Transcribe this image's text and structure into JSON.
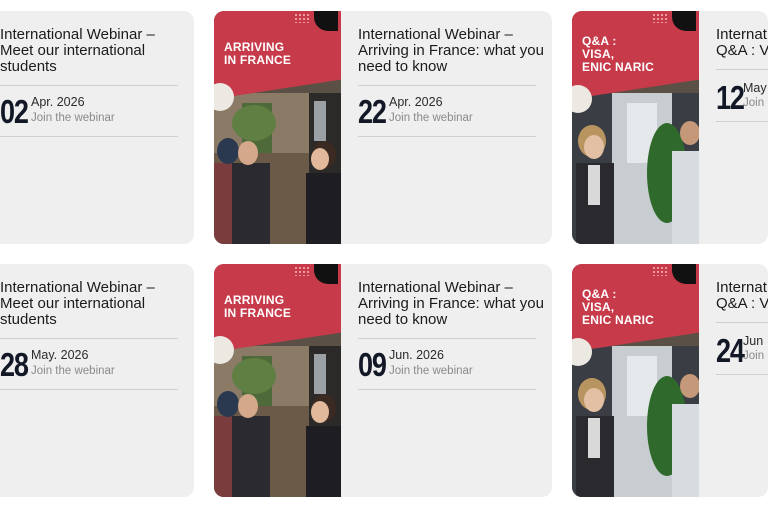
{
  "cards": [
    {
      "title": "International Webinar – Meet our international students",
      "day": "02",
      "month": "Apr. 2026",
      "join": "Join the webinar"
    },
    {
      "banner": "ARRIVING IN FRANCE",
      "title": "International Webinar – Arriving in France: what you need to know",
      "day": "22",
      "month": "Apr. 2026",
      "join": "Join the webinar"
    },
    {
      "banner": "Q&A : VISA, ENIC NARIC",
      "title": "Internat Q&A : Vi",
      "day": "12",
      "month": "May",
      "join": "Join"
    },
    {
      "title": "International Webinar – Meet our international students",
      "day": "28",
      "month": "May. 2026",
      "join": "Join the webinar"
    },
    {
      "banner": "ARRIVING IN FRANCE",
      "title": "International Webinar – Arriving in France: what you need to know",
      "day": "09",
      "month": "Jun. 2026",
      "join": "Join the webinar"
    },
    {
      "banner": "Q&A : VISA, ENIC NARIC",
      "title": "Internat Q&A : Vi",
      "day": "24",
      "month": "Jun",
      "join": "Join"
    }
  ],
  "colors": {
    "banner": "#c63a4a",
    "card": "#efefef",
    "day": "#121826"
  }
}
